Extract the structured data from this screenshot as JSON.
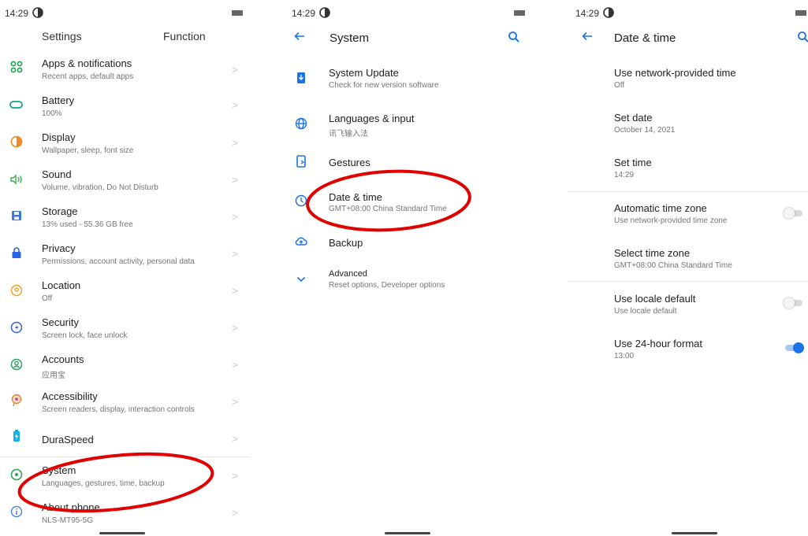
{
  "status": {
    "time": "14:29"
  },
  "colors": {
    "accent": "#1a73e8",
    "highlight_ellipse": "#e00000",
    "toggle_on": "#1a73e8"
  },
  "settings": {
    "header_left": "Settings",
    "header_right": "Function",
    "items": [
      {
        "title": "Apps & notifications",
        "subtitle": "Recent apps, default apps",
        "icon": "apps-icon",
        "color": "#18a34a"
      },
      {
        "title": "Battery",
        "subtitle": "100%",
        "icon": "battery-icon",
        "color": "#0fa58f"
      },
      {
        "title": "Display",
        "subtitle": "Wallpaper, sleep, font size",
        "icon": "display-icon",
        "color": "#f28a1e"
      },
      {
        "title": "Sound",
        "subtitle": "Volume, vibration, Do Not Disturb",
        "icon": "sound-icon",
        "color": "#3db04a"
      },
      {
        "title": "Storage",
        "subtitle": "13% used - 55.36 GB free",
        "icon": "storage-icon",
        "color": "#3a78e0"
      },
      {
        "title": "Privacy",
        "subtitle": "Permissions, account activity, personal data",
        "icon": "privacy-icon",
        "color": "#2c62e8"
      },
      {
        "title": "Location",
        "subtitle": "Off",
        "icon": "location-icon",
        "color": "#f2a024"
      },
      {
        "title": "Security",
        "subtitle": "Screen lock, face unlock",
        "icon": "security-icon",
        "color": "#3563d8"
      },
      {
        "title": "Accounts",
        "subtitle": "应用宝",
        "icon": "accounts-icon",
        "color": "#25a05f"
      },
      {
        "title": "Accessibility",
        "subtitle": "Screen readers, display, interaction controls",
        "icon": "accessibility-icon",
        "color": "#ee7f2a"
      },
      {
        "title": "DuraSpeed",
        "subtitle": "",
        "icon": "duraspeed-icon",
        "color": "#16b0e8"
      },
      {
        "title": "System",
        "subtitle": "Languages, gestures, time, backup",
        "icon": "system-icon",
        "color": "#2aa653"
      },
      {
        "title": "About phone",
        "subtitle": "NLS-MT95-5G",
        "icon": "info-icon",
        "color": "#3a7de0"
      }
    ]
  },
  "system": {
    "title": "System",
    "items": [
      {
        "title": "System Update",
        "subtitle": "Check for new version software",
        "icon": "system-update-icon"
      },
      {
        "title": "Languages & input",
        "subtitle": "讯飞输入法",
        "icon": "globe-icon"
      },
      {
        "title": "Gestures",
        "subtitle": "",
        "icon": "gestures-icon"
      },
      {
        "title": "Date & time",
        "subtitle": "GMT+08:00 China Standard Time",
        "icon": "clock-icon"
      },
      {
        "title": "Backup",
        "subtitle": "",
        "icon": "backup-icon"
      },
      {
        "title": "Advanced",
        "subtitle": "Reset options, Developer options",
        "icon": "chevron-down-icon"
      }
    ]
  },
  "datetime": {
    "title": "Date & time",
    "items": [
      {
        "title": "Use network-provided time",
        "subtitle": "Off"
      },
      {
        "title": "Set date",
        "subtitle": "October 14, 2021"
      },
      {
        "title": "Set time",
        "subtitle": "14:29"
      },
      {
        "title": "Automatic time zone",
        "subtitle": "Use network-provided time zone",
        "toggle": false
      },
      {
        "title": "Select time zone",
        "subtitle": "GMT+08:00 China Standard Time"
      },
      {
        "title": "Use locale default",
        "subtitle": "Use locale default",
        "toggle": false
      },
      {
        "title": "Use 24-hour format",
        "subtitle": "13:00",
        "toggle": true
      }
    ]
  }
}
